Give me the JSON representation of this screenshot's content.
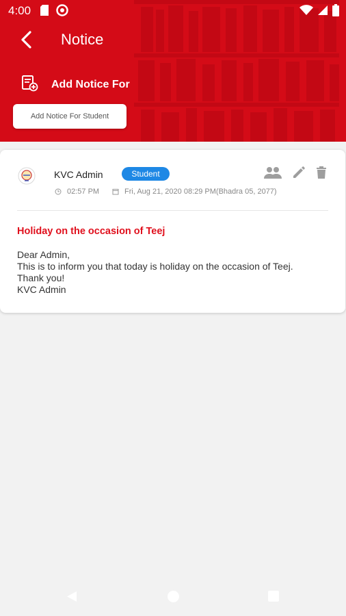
{
  "status_bar": {
    "time": "4:00",
    "left_icons": [
      "sd-card-icon",
      "sync-icon"
    ],
    "right_icons": [
      "wifi-icon",
      "signal-icon",
      "battery-icon"
    ]
  },
  "header": {
    "title": "Notice",
    "add_notice_label": "Add Notice For",
    "add_student_button": "Add Notice For Student",
    "brand_color": "#d40b17"
  },
  "notice": {
    "author": "KVC Admin",
    "audience_badge": "Student",
    "time": "02:57 PM",
    "date": "Fri, Aug 21, 2020 08:29 PM(Bhadra 05, 2077)",
    "title": "Holiday on the occasion of Teej",
    "body_lines": [
      "Dear Admin,",
      "This is to inform you that today is holiday on the occasion of Teej.",
      "Thank you!",
      "KVC Admin"
    ],
    "actions": [
      "group-icon",
      "edit-icon",
      "delete-icon"
    ],
    "title_color": "#e0101d",
    "badge_color": "#1e88e5"
  }
}
